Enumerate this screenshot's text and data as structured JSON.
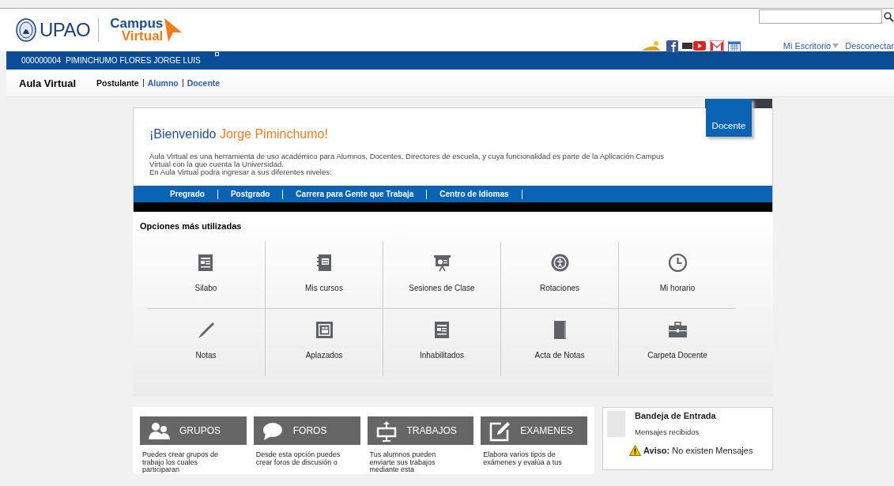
{
  "header": {
    "logo": "UPAO",
    "brand": [
      "Campus",
      "Virtual"
    ],
    "social": [
      {
        "kind": "pin"
      },
      {
        "kind": "facebook"
      },
      {
        "kind": "video"
      },
      {
        "kind": "mail"
      },
      {
        "kind": "calendar"
      }
    ],
    "links": [
      "Mi Escritorio",
      "Desconectar"
    ]
  },
  "user_bar": {
    "code": "000000004",
    "name": "PIMINCHUMO FLORES JORGE LUIS"
  },
  "sub_nav": {
    "title": "Aula Virtual",
    "roles": [
      {
        "label": "Postulante",
        "selected": true
      },
      {
        "label": "Alumno",
        "selected": false
      },
      {
        "label": "Docente",
        "selected": false
      }
    ]
  },
  "welcome": {
    "greeting": "¡Bienvenido",
    "name": "Jorge Piminchumo!",
    "description": "Aula Virtual es una herramienta de uso académico para Alumnos, Docentes, Directores de escuela, y cuya funcionalidad es parte de la Aplicación Campus Virtual con la que cuenta la Universidad.",
    "prompt": "En Aula Virtual podra ingresar a sus diferentes niveles:",
    "role_tab": "Docente"
  },
  "levels": [
    "Pregrado",
    "Postgrado",
    "Carrera para Gente que Trabaja",
    "Centro de Idiomas"
  ],
  "options": {
    "title": "Opciones más utilizadas",
    "items": [
      {
        "label": "Silabo",
        "kind": "document"
      },
      {
        "label": "Mis cursos",
        "kind": "notebook"
      },
      {
        "label": "Sesiones de Clase",
        "kind": "easel"
      },
      {
        "label": "Rotaciones",
        "kind": "person"
      },
      {
        "label": "Mi horario",
        "kind": "clock"
      },
      {
        "label": "Notas",
        "kind": "pen"
      },
      {
        "label": "Aplazados",
        "kind": "frame"
      },
      {
        "label": "Inhabilitados",
        "kind": "document"
      },
      {
        "label": "Acta de Notas",
        "kind": "book"
      },
      {
        "label": "Carpeta Docente",
        "kind": "briefcase"
      }
    ]
  },
  "features": [
    {
      "title": "GRUPOS",
      "kind": "people",
      "text": "Puedes crear grupos de trabajo los cuales participaran"
    },
    {
      "title": "FOROS",
      "kind": "bubble",
      "text": "Desde esta opción puedes crear foros de discusión o"
    },
    {
      "title": "TRABAJOS",
      "kind": "upload",
      "text": "Tus alumnos pueden enviarte sus trabajos mediante esta"
    },
    {
      "title": "EXAMENES",
      "kind": "edit",
      "text": "Elabora varios tipos de exámenes y evalúa a tus"
    }
  ],
  "inbox": {
    "title": "Bandeja de Entrada",
    "subtitle": "Mensajes recibidos",
    "notice_label": "Aviso:",
    "notice": "No existen Mensajes"
  }
}
